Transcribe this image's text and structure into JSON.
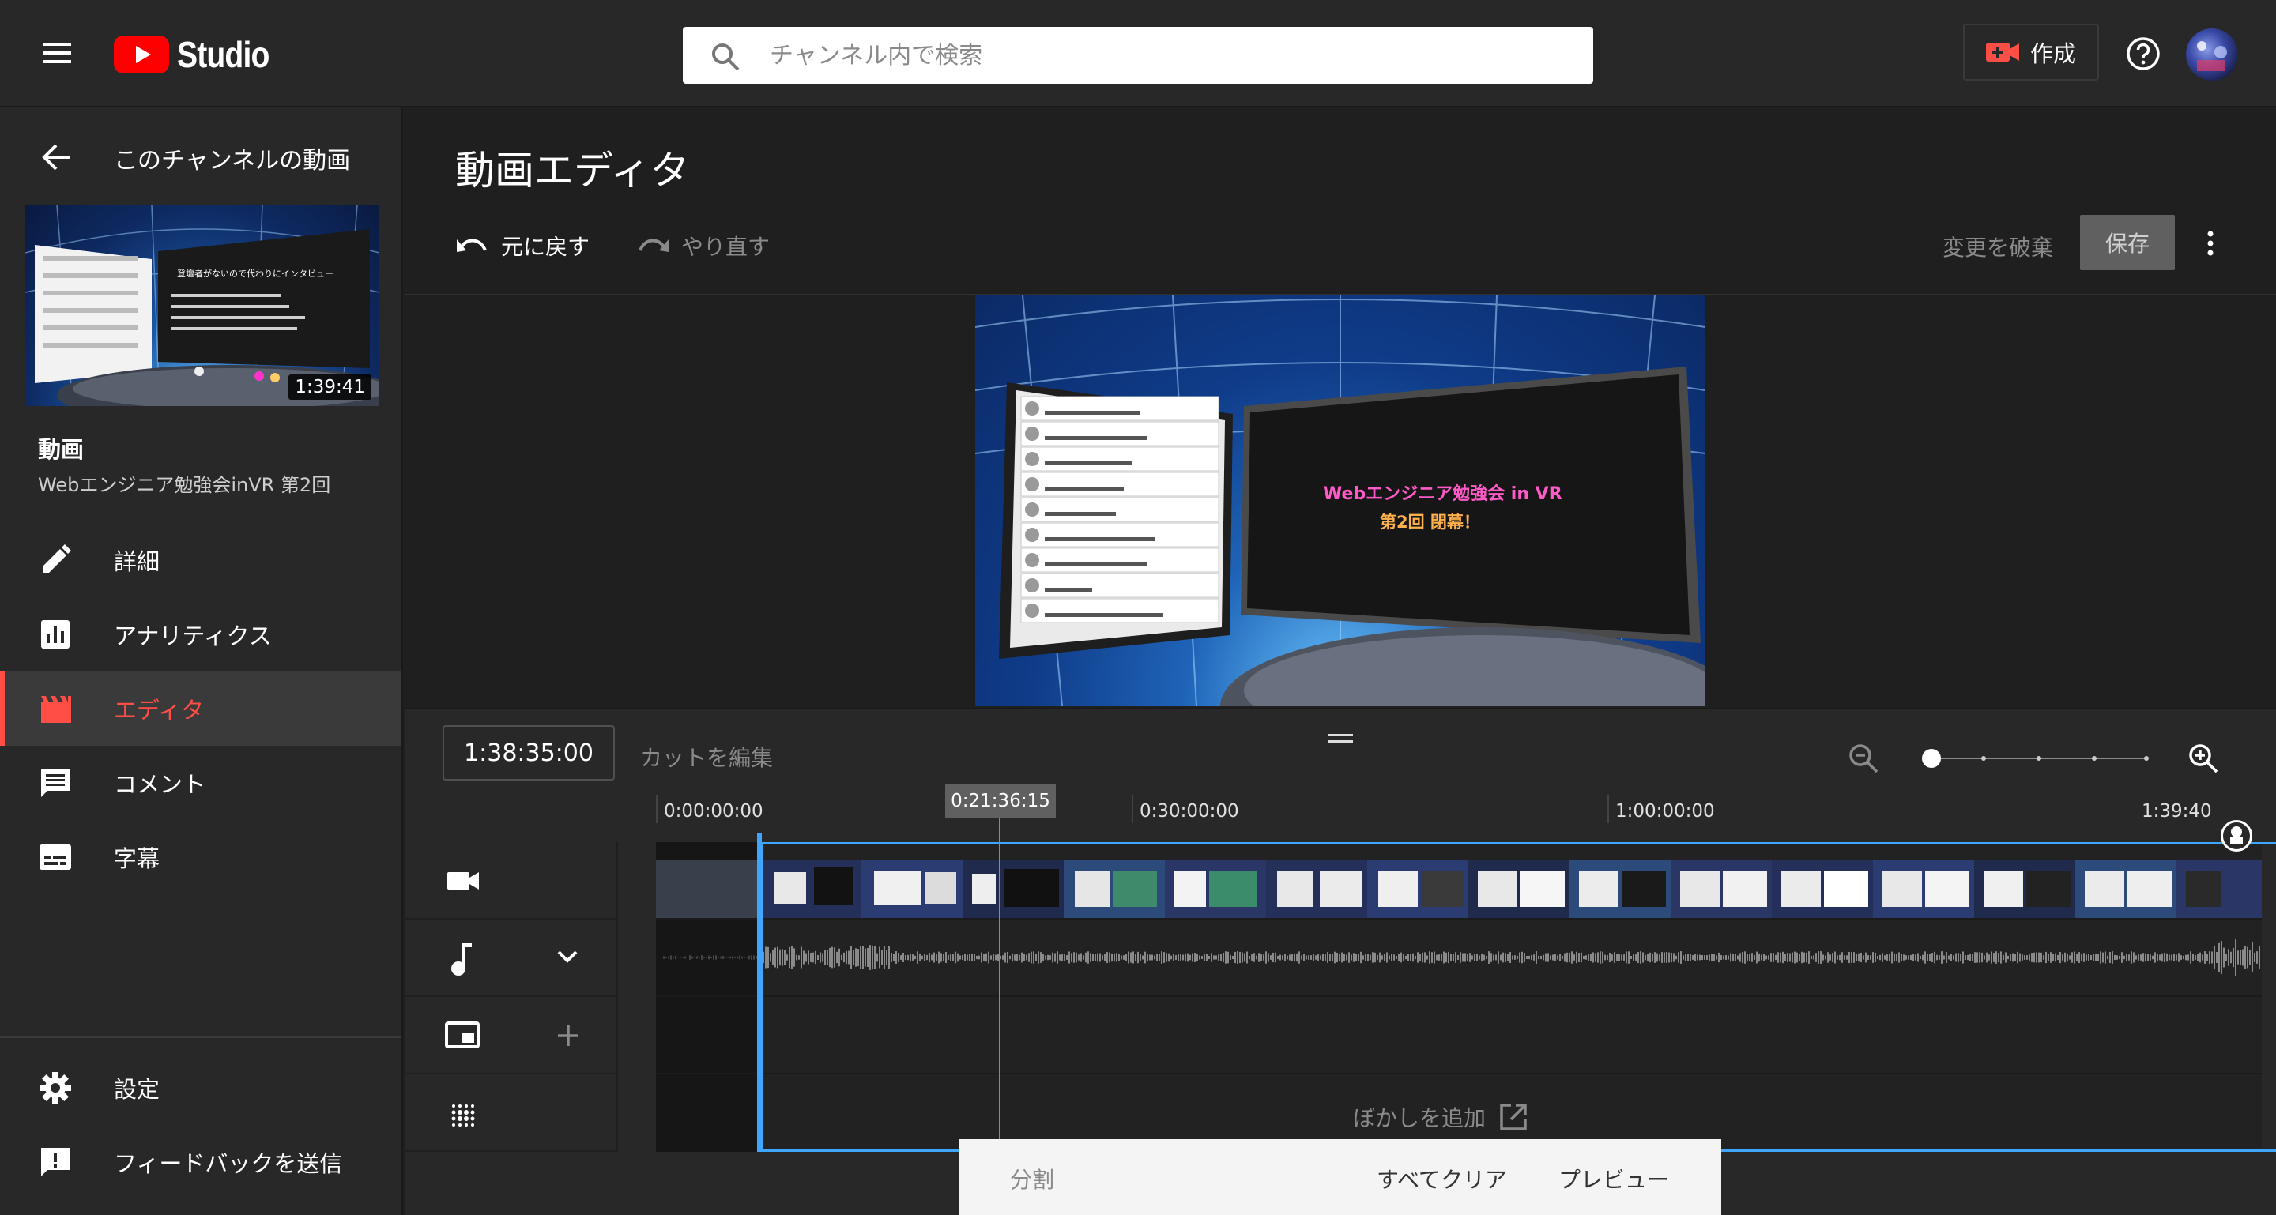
{
  "header": {
    "brand": "Studio",
    "search_placeholder": "チャンネル内で検索",
    "create_label": "作成"
  },
  "sidebar": {
    "back_label": "このチャンネルの動画",
    "thumb_duration": "1:39:41",
    "section_title": "動画",
    "video_title": "Webエンジニア勉強会inVR 第2回",
    "thumb_heading": "登壇者がないので代わりにインタビュー",
    "items": [
      {
        "label": "詳細",
        "icon": "pencil-icon"
      },
      {
        "label": "アナリティクス",
        "icon": "analytics-icon"
      },
      {
        "label": "エディタ",
        "icon": "editor-clapper-icon",
        "active": true
      },
      {
        "label": "コメント",
        "icon": "comment-icon"
      },
      {
        "label": "字幕",
        "icon": "subtitles-icon"
      }
    ],
    "footer_items": [
      {
        "label": "設定",
        "icon": "gear-icon"
      },
      {
        "label": "フィードバックを送信",
        "icon": "feedback-icon"
      }
    ]
  },
  "editor": {
    "title": "動画エディタ",
    "undo_label": "元に戻す",
    "redo_label": "やり直す",
    "discard_label": "変更を破棄",
    "save_label": "保存",
    "preview_slide_line1": "Webエンジニア勉強会 in VR",
    "preview_slide_line2": "第2回 閉幕！"
  },
  "timeline": {
    "current_time": "1:38:35:00",
    "edit_cut_label": "カットを編集",
    "playhead_time": "0:21:36:15",
    "ruler": [
      "0:00:00:00",
      "0:30:00:00",
      "1:00:00:00",
      "1:39:40"
    ],
    "blur_label": "ぼかしを追加",
    "zoom_level": 0
  },
  "bottom_bar": {
    "split_label": "分割",
    "clear_all_label": "すべてクリア",
    "preview_label": "プレビュー"
  },
  "colors": {
    "accent": "#ff4e45",
    "selection": "#3ea6ff",
    "youtube_red": "#ff0000"
  }
}
